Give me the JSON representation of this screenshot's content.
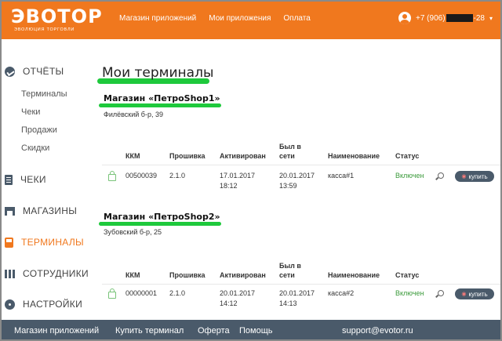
{
  "header": {
    "logo_text": "ЭВОТОР",
    "logo_subtext": "ЭВОЛЮЦИЯ ТОРГОВЛИ",
    "nav": [
      "Магазин приложений",
      "Мои приложения",
      "Оплата"
    ],
    "phone_prefix": "+7 (906)",
    "phone_suffix": "-28"
  },
  "sidebar": {
    "reports": "ОТЧЁТЫ",
    "report_items": [
      "Терминалы",
      "Чеки",
      "Продажи",
      "Скидки"
    ],
    "checks": "ЧЕКИ",
    "stores": "МАГАЗИНЫ",
    "terminals": "ТЕРМИНАЛЫ",
    "staff": "СОТРУДНИКИ",
    "settings": "НАСТРОЙКИ"
  },
  "main": {
    "title": "Мои терминалы",
    "columns": [
      "ККМ",
      "Прошивка",
      "Активирован",
      "Был в сети",
      "Наименование",
      "Статус"
    ],
    "columns_split": {
      "online_line1": "Был в",
      "online_line2": "сети"
    },
    "stores": [
      {
        "name": "Магазин «ПетроShop1»",
        "address": "Филёвский б-р, 39",
        "rows": [
          {
            "kkm": "00500039",
            "firmware": "2.1.0",
            "activated_date": "17.01.2017",
            "activated_time": "18:12",
            "online_date": "20.01.2017",
            "online_time": "13:59",
            "name": "касса#1",
            "status": "Включен",
            "action": "купить"
          }
        ]
      },
      {
        "name": "Магазин «ПетроShop2»",
        "address": "Зубовский б-р, 25",
        "rows": [
          {
            "kkm": "00000001",
            "firmware": "2.1.0",
            "activated_date": "20.01.2017",
            "activated_time": "14:12",
            "online_date": "20.01.2017",
            "online_time": "14:13",
            "name": "касса#2",
            "status": "Включен",
            "action": "купить"
          }
        ]
      }
    ]
  },
  "footer": {
    "links": [
      "Магазин приложений",
      "Купить терминал",
      "Оферта",
      "Помощь"
    ],
    "email": "support@evotor.ru"
  },
  "colors": {
    "brand_orange": "#f0781e",
    "nav_dark": "#4a5a6a",
    "highlight_green": "#1ec93c",
    "status_green": "#3a9a3a"
  },
  "icons": {
    "reports": "chart-circle-icon",
    "checks": "receipt-icon",
    "stores": "store-icon",
    "terminals": "terminal-icon",
    "staff": "staff-icon",
    "settings": "gear-icon",
    "row": "shopping-bag-icon",
    "search": "search-icon",
    "buy": "cart-icon"
  }
}
